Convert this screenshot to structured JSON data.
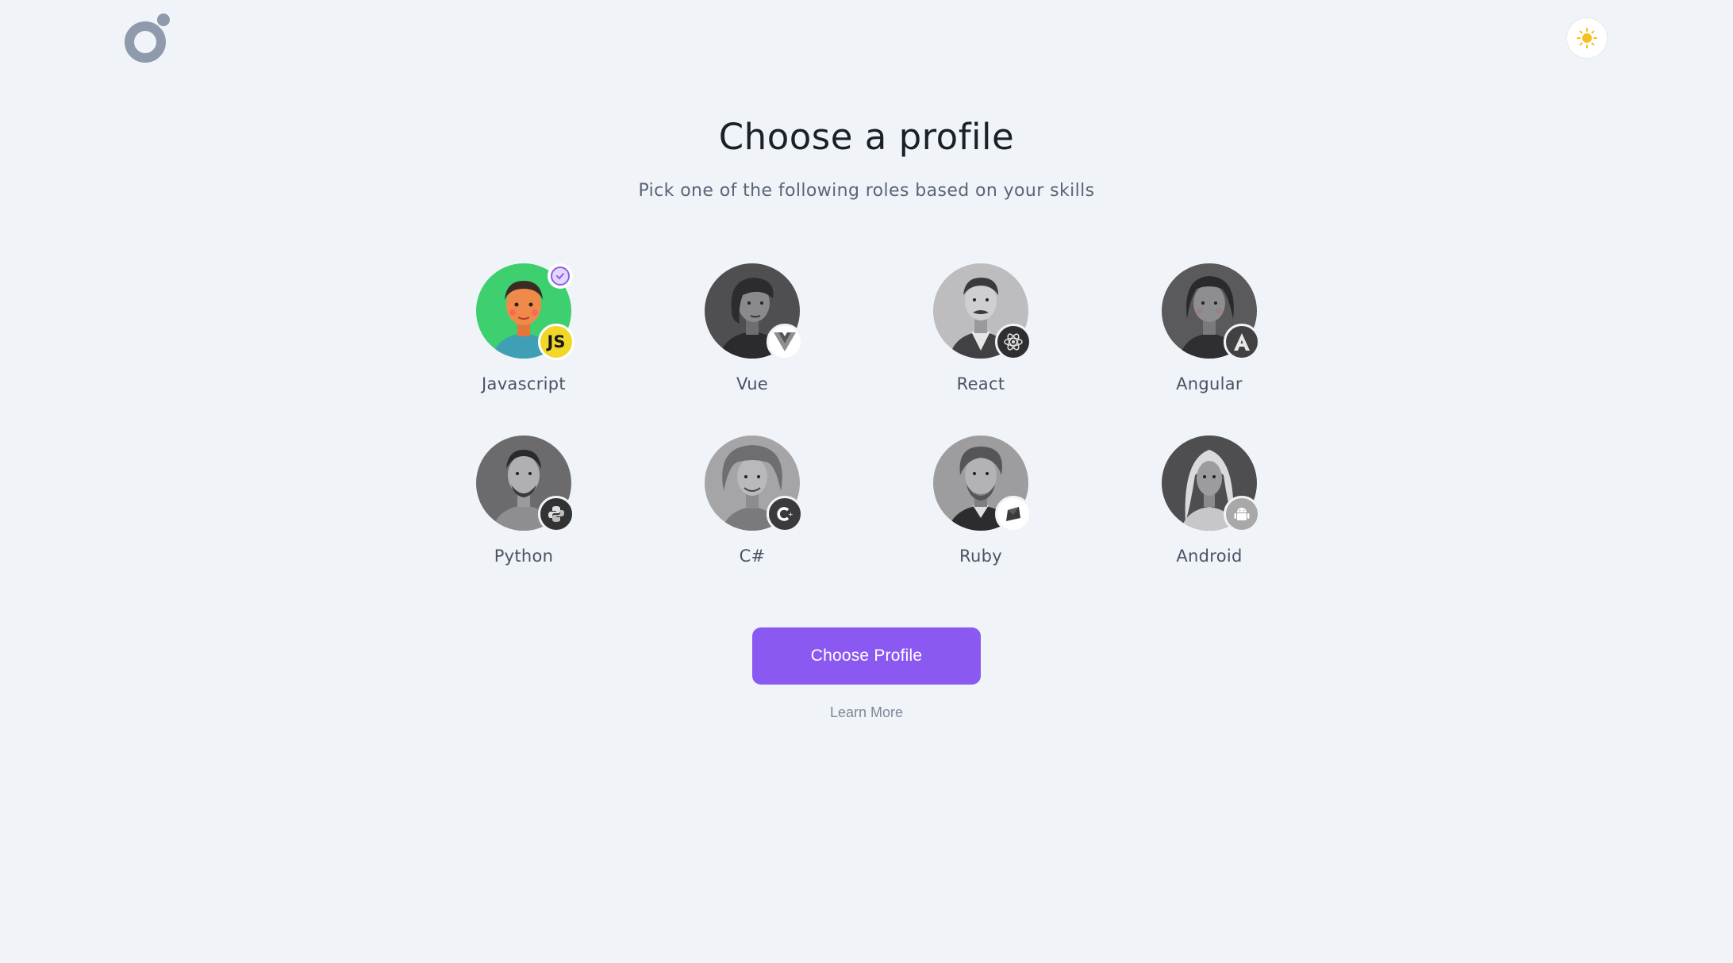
{
  "header": {
    "logo_icon": "brand-logo-icon",
    "theme_toggle_icon": "sun-icon",
    "accent_color": "#f2c11d"
  },
  "main": {
    "title": "Choose a profile",
    "subtitle": "Pick one of the following roles based on your skills"
  },
  "profiles": [
    {
      "label": "Javascript",
      "badge": "JS",
      "badge_icon": "javascript-icon",
      "selected": true
    },
    {
      "label": "Vue",
      "badge_icon": "vue-icon",
      "selected": false
    },
    {
      "label": "React",
      "badge_icon": "react-icon",
      "selected": false
    },
    {
      "label": "Angular",
      "badge_icon": "angular-icon",
      "selected": false
    },
    {
      "label": "Python",
      "badge_icon": "python-icon",
      "selected": false
    },
    {
      "label": "C#",
      "badge_icon": "csharp-icon",
      "selected": false
    },
    {
      "label": "Ruby",
      "badge_icon": "ruby-icon",
      "selected": false
    },
    {
      "label": "Android",
      "badge_icon": "android-icon",
      "selected": false
    }
  ],
  "actions": {
    "primary_label": "Choose Profile",
    "primary_color": "#8c58f2",
    "secondary_label": "Learn More"
  }
}
